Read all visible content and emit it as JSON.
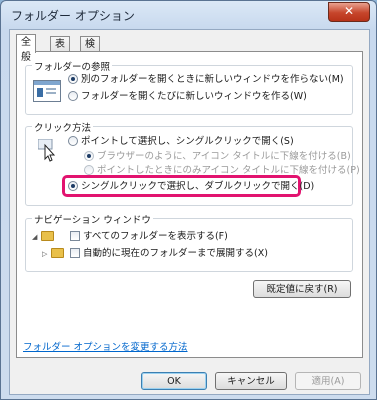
{
  "window": {
    "title": "フォルダー オプション",
    "close_label": "✕"
  },
  "tabs": [
    {
      "label": "全般",
      "active": true
    },
    {
      "label": "表示",
      "active": false
    },
    {
      "label": "検索",
      "active": false
    }
  ],
  "browse_group": {
    "label": "フォルダーの参照",
    "options": [
      {
        "label": "別のフォルダーを開くときに新しいウィンドウを作らない(M)",
        "selected": true
      },
      {
        "label": "フォルダーを開くたびに新しいウィンドウを作る(W)",
        "selected": false
      }
    ]
  },
  "click_group": {
    "label": "クリック方法",
    "options": [
      {
        "label": "ポイントして選択し、シングルクリックで開く(S)",
        "selected": false
      },
      {
        "label": "ブラウザーのように、アイコン タイトルに下線を付ける(B)",
        "selected": true,
        "disabled": true
      },
      {
        "label": "ポイントしたときにのみアイコン タイトルに下線を付ける(P)",
        "selected": false,
        "disabled": true
      },
      {
        "label": "シングルクリックで選択し、ダブルクリックで開く(D)",
        "selected": true
      }
    ]
  },
  "nav_group": {
    "label": "ナビゲーション ウィンドウ",
    "checks": [
      {
        "label": "すべてのフォルダーを表示する(F)",
        "checked": false
      },
      {
        "label": "自動的に現在のフォルダーまで展開する(X)",
        "checked": false
      }
    ]
  },
  "restore_button": "既定値に戻す(R)",
  "help_link": "フォルダー オプションを変更する方法",
  "footer": {
    "ok": "OK",
    "cancel": "キャンセル",
    "apply": "適用(A)"
  },
  "colors": {
    "highlight": "#e2136f",
    "link": "#0066cc"
  },
  "icons": {
    "browse_group": "window-preview-icon",
    "click_group": "cursor-icon",
    "nav_group": "folder-icon"
  }
}
